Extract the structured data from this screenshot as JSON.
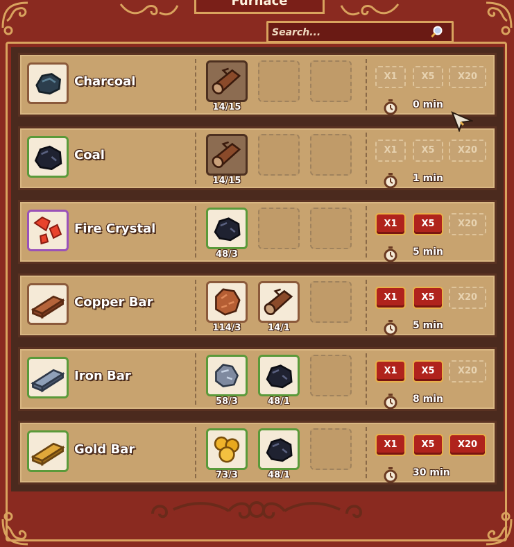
{
  "window": {
    "title": "Furnace"
  },
  "search": {
    "placeholder": "Search..."
  },
  "colors": {
    "frame": "#8a2a20",
    "gold": "#d9a35e",
    "panel": "#c8a36f",
    "button_red": "#b0231c"
  },
  "recipes": [
    {
      "name": "Charcoal",
      "icon": "charcoal-icon",
      "tier": 0,
      "ingredients": [
        {
          "icon": "log-icon",
          "count": "14/15",
          "style": "brown"
        },
        null,
        null
      ],
      "buttons": [
        {
          "label": "X1",
          "enabled": false
        },
        {
          "label": "X5",
          "enabled": false
        },
        {
          "label": "X20",
          "enabled": false
        }
      ],
      "time": "0 min"
    },
    {
      "name": "Coal",
      "icon": "coal-icon",
      "tier": 1,
      "ingredients": [
        {
          "icon": "log-icon",
          "count": "14/15",
          "style": "brown"
        },
        null,
        null
      ],
      "buttons": [
        {
          "label": "X1",
          "enabled": false
        },
        {
          "label": "X5",
          "enabled": false
        },
        {
          "label": "X20",
          "enabled": false
        }
      ],
      "time": "1 min"
    },
    {
      "name": "Fire Crystal",
      "icon": "fire-crystal-icon",
      "tier": 2,
      "ingredients": [
        {
          "icon": "coal-icon",
          "count": "48/3",
          "style": "green"
        },
        null,
        null
      ],
      "buttons": [
        {
          "label": "X1",
          "enabled": true
        },
        {
          "label": "X5",
          "enabled": true
        },
        {
          "label": "X20",
          "enabled": false
        }
      ],
      "time": "5 min"
    },
    {
      "name": "Copper Bar",
      "icon": "copper-bar-icon",
      "tier": 0,
      "ingredients": [
        {
          "icon": "copper-ore-icon",
          "count": "114/3",
          "style": "tan"
        },
        {
          "icon": "log-icon",
          "count": "14/1",
          "style": "tan"
        },
        null
      ],
      "buttons": [
        {
          "label": "X1",
          "enabled": true
        },
        {
          "label": "X5",
          "enabled": true
        },
        {
          "label": "X20",
          "enabled": false
        }
      ],
      "time": "5 min"
    },
    {
      "name": "Iron Bar",
      "icon": "iron-bar-icon",
      "tier": 1,
      "ingredients": [
        {
          "icon": "iron-ore-icon",
          "count": "58/3",
          "style": "green"
        },
        {
          "icon": "coal-icon",
          "count": "48/1",
          "style": "green"
        },
        null
      ],
      "buttons": [
        {
          "label": "X1",
          "enabled": true
        },
        {
          "label": "X5",
          "enabled": true
        },
        {
          "label": "X20",
          "enabled": false
        }
      ],
      "time": "8 min"
    },
    {
      "name": "Gold Bar",
      "icon": "gold-bar-icon",
      "tier": 1,
      "ingredients": [
        {
          "icon": "gold-ore-icon",
          "count": "73/3",
          "style": "green"
        },
        {
          "icon": "coal-icon",
          "count": "48/1",
          "style": "green"
        },
        null
      ],
      "buttons": [
        {
          "label": "X1",
          "enabled": true
        },
        {
          "label": "X5",
          "enabled": true
        },
        {
          "label": "X20",
          "enabled": true
        }
      ],
      "time": "30 min"
    }
  ]
}
